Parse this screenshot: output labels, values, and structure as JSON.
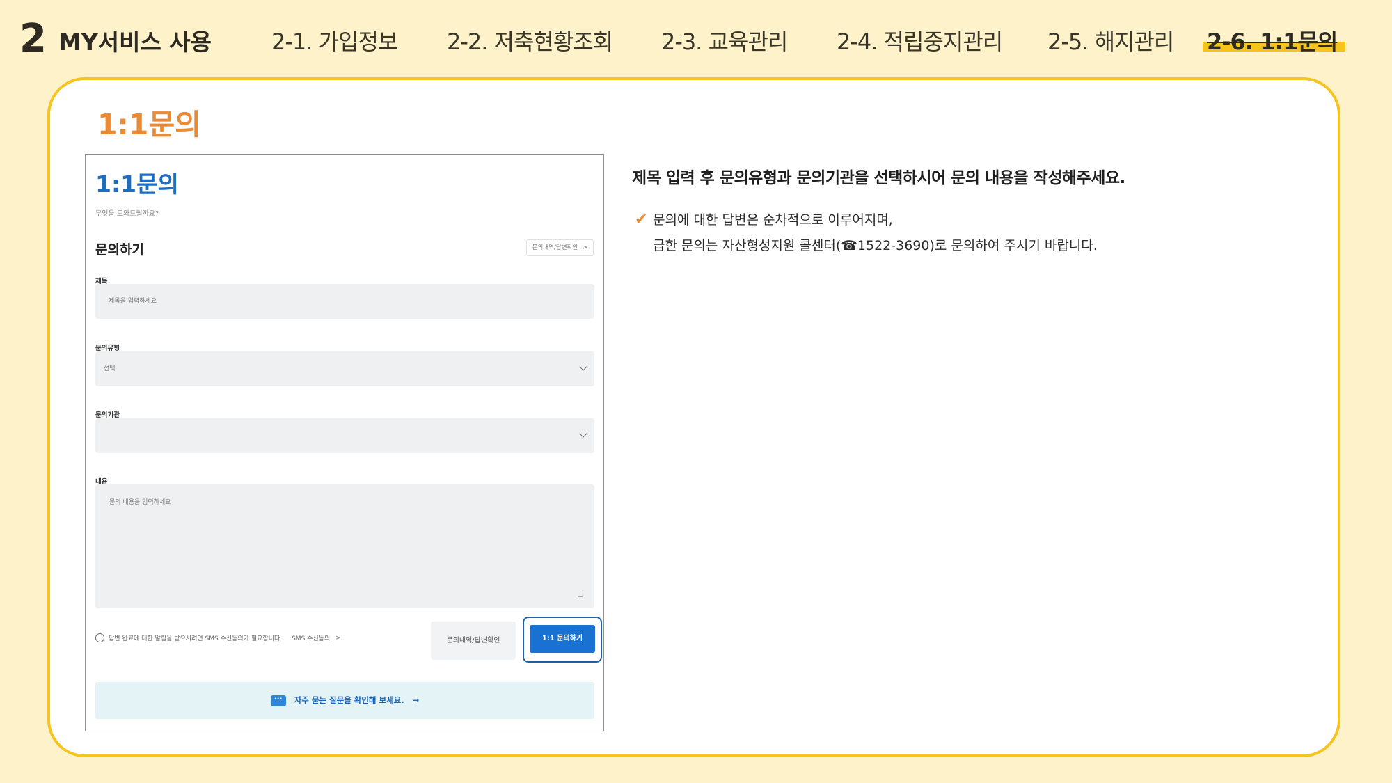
{
  "header": {
    "section_number": "2",
    "section_title": "MY서비스 사용",
    "tabs": [
      {
        "label": "2-1. 가입정보",
        "active": false
      },
      {
        "label": "2-2. 저축현황조회",
        "active": false
      },
      {
        "label": "2-3. 교육관리",
        "active": false
      },
      {
        "label": "2-4. 적립중지관리",
        "active": false
      },
      {
        "label": "2-5. 해지관리",
        "active": false
      },
      {
        "label": "2-6. 1:1문의",
        "active": true
      }
    ]
  },
  "card": {
    "title": "1:1문의"
  },
  "screenshot": {
    "title": "1:1문의",
    "subtitle": "무엇을 도와드릴까요?",
    "section_heading": "문의하기",
    "history_link": "문의내역/답변확인",
    "history_link_arrow": ">",
    "fields": {
      "subject_label": "제목",
      "subject_placeholder": "제목을 입력하세요",
      "type_label": "문의유형",
      "type_value": "선택",
      "org_label": "문의기관",
      "org_value": "",
      "content_label": "내용",
      "content_placeholder": "문의 내용을 입력하세요"
    },
    "notice_icon": "i",
    "notice": "답변 완료에 대한 알림을 받으시려면 SMS 수신동의가 필요합니다.",
    "sms_link": "SMS 수신동의",
    "sms_link_arrow": ">",
    "history_button": "문의내역/답변확인",
    "submit_button": "1:1 문의하기",
    "faq_icon": "···",
    "faq_text": "자주 묻는 질문을 확인해 보세요.",
    "faq_arrow": "→"
  },
  "description": {
    "main": "제목 입력 후 문의유형과 문의기관을 선택하시어 문의 내용을 작성해주세요.",
    "check_icon": "✔",
    "line1": "문의에 대한 답변은 순차적으로 이루어지며,",
    "line2": "급한 문의는 자산형성지원 콜센터(☎1522-3690)로 문의하여 주시기 바랍니다."
  },
  "colors": {
    "background": "#fdf2c9",
    "card_border": "#f5c420",
    "accent_orange": "#ea8a35",
    "highlight_yellow": "#f5c41d",
    "screenshot_blue": "#1972d2"
  }
}
